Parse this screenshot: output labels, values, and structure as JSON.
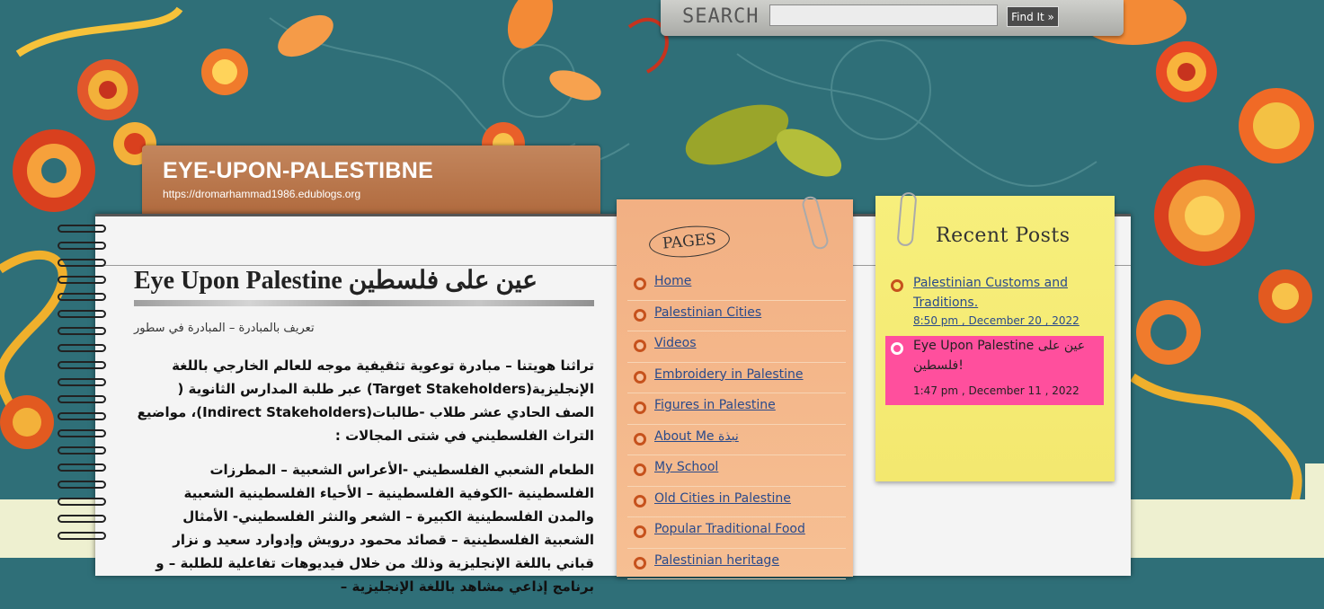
{
  "search": {
    "label": "SEARCH",
    "placeholder": "",
    "button_label": "Find It »"
  },
  "header": {
    "title": "EYE-UPON-PALESTIBNE",
    "url": "https://dromarhammad1986.edublogs.org"
  },
  "post": {
    "title": "Eye Upon Palestine عين على فلسطين",
    "subtitle": "تعريف بالمبادرة – المبادرة في سطور",
    "paragraphs": [
      "تراثنا هويتنا – مبادرة توعوية تثقيفية موجه للعالم الخارجي باللغة الإنجليزية(Target Stakeholders) عبر طلبة المدارس الثانوية ( الصف الحادي عشر طلاب -طالبات(Indirect Stakeholders)، مواضيع التراث الفلسطيني في شتى المجالات :",
      "الطعام الشعبي الفلسطيني -الأعراس الشعبية – المطرزات الفلسطينية -الكوفية الفلسطينية – الأحياء الفلسطينية الشعبية والمدن الفلسطينية الكبيرة – الشعر والنثر الفلسطيني- الأمثال الشعبية الفلسطينية – قصائد محمود درويش وإدوارد سعيد و نزار قباني باللغة الإنجليزية وذلك من خلال فيديوهات تفاعلية للطلبة – و برنامج إذاعي مشاهد باللغة الإنجليزية –"
    ]
  },
  "pages": {
    "heading": "PAGES",
    "items": [
      "Home",
      "Palestinian Cities",
      "Videos",
      "Embroidery in Palestine",
      "Figures in Palestine",
      "About Me نبذة",
      "My School",
      "Old Cities in Palestine",
      "Popular Traditional Food",
      "Palestinian heritage"
    ]
  },
  "recent": {
    "heading": "Recent Posts",
    "items": [
      {
        "title": "Palestinian Customs and Traditions.",
        "date": "8:50 pm , December 20 , 2022"
      },
      {
        "title": "Eye Upon Palestine عين على فلسطين!",
        "date": "1:47 pm , December 11 , 2022"
      }
    ]
  },
  "colors": {
    "background": "#2f6f78",
    "title_tag": "#b06a3e",
    "pages_note": "#f6bf93",
    "recent_note": "#f7ef7c",
    "active_highlight": "#ff4f9d",
    "link": "#2a4a8b",
    "bullet": "#c6521d"
  }
}
